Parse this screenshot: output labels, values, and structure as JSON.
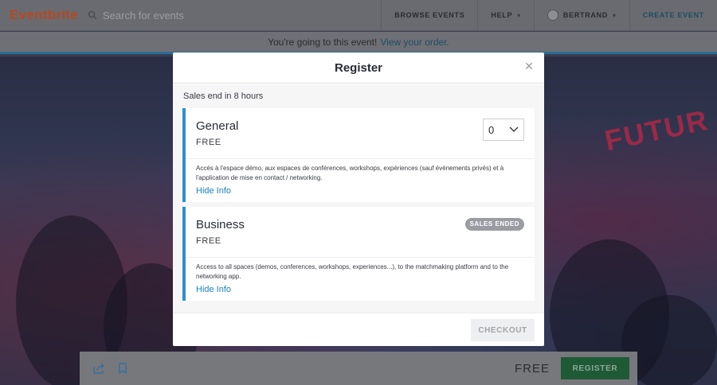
{
  "header": {
    "logo": "Eventbrite",
    "search_placeholder": "Search for events",
    "browse_events": "BROWSE EVENTS",
    "help": "HELP",
    "user_name": "BERTRAND",
    "create_event": "CREATE EVENT"
  },
  "banner": {
    "text": "You're going to this event!",
    "link": "View your order."
  },
  "hero": {
    "sign_text": "FUTUR"
  },
  "bottom_bar": {
    "price": "FREE",
    "register_label": "REGISTER"
  },
  "modal": {
    "title": "Register",
    "sales_end": "Sales end in 8 hours",
    "tickets": [
      {
        "name": "General",
        "price": "FREE",
        "quantity": "0",
        "description": "Accès à l'espace démo, aux espaces de conférences, workshops, expériences (sauf événements privés) et à l'application de mise en contact / networking.",
        "toggle": "Hide Info"
      },
      {
        "name": "Business",
        "price": "FREE",
        "status": "SALES ENDED",
        "description": "Access to all spaces (demos, conferences, workshops, experiences...), to the matchmaking platform and to the networking app.",
        "toggle": "Hide Info"
      }
    ],
    "checkout_label": "CHECKOUT"
  },
  "colors": {
    "accent_blue": "#2d8fd0",
    "link_blue": "#1b82c2",
    "brand_orange": "#b24a23",
    "register_green": "#1f5a36"
  }
}
